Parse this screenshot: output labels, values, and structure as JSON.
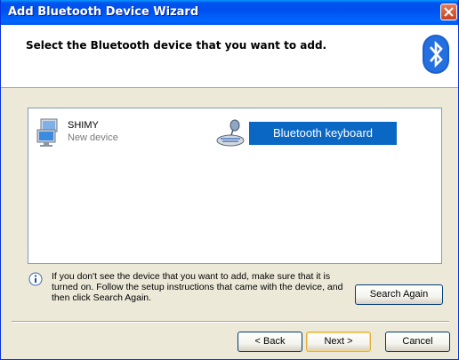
{
  "window": {
    "title": "Add Bluetooth Device Wizard"
  },
  "header": {
    "title": "Select the Bluetooth device that you want to add."
  },
  "devices": [
    {
      "name": "SHIMY",
      "status": "New device",
      "icon": "computer-icon",
      "selected": false
    },
    {
      "name": "Bluetooth keyboard",
      "status": "",
      "icon": "keyboard-icon",
      "selected": true
    }
  ],
  "info": {
    "text": "If you don't see the device that you want to add, make sure that it is turned on. Follow the setup instructions that came with the device, and then click Search Again."
  },
  "buttons": {
    "search_again": "Search Again",
    "back": "< Back",
    "next": "Next >",
    "cancel": "Cancel"
  },
  "colors": {
    "title_bar": "#0054e3",
    "selection": "#0a67c3",
    "dialog_bg": "#ece9d8"
  }
}
